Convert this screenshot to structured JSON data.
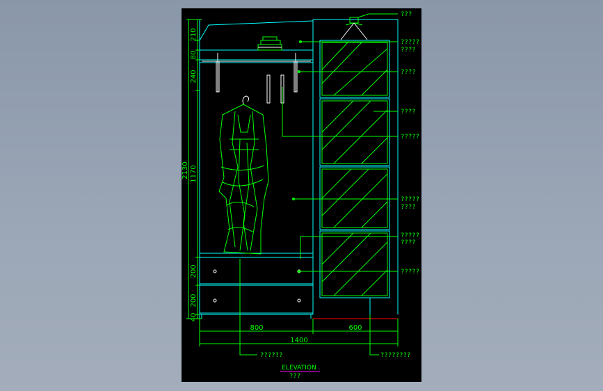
{
  "drawing": {
    "title": "ELEVATION",
    "subtitle": "???",
    "colors": {
      "viewport_bg": "#8e9aab",
      "sheet": "#000000",
      "cabinet": "#00ffff",
      "dimension": "#00ff00",
      "figure": "#00ff00",
      "hardware": "#ffffff",
      "floor": "#ff0000",
      "title_underline": "#ff00ff"
    }
  },
  "dimensions": {
    "vertical_outer": [
      "210",
      "80",
      "240",
      "2130",
      "1170",
      "200",
      "200",
      "40"
    ],
    "vertical_inner": [
      "1170"
    ],
    "horizontal": [
      "800",
      "600",
      "1400"
    ]
  },
  "annotations": {
    "right": [
      "???",
      "?????",
      "????",
      "????",
      "????",
      "?????",
      "?????",
      "????",
      "?????",
      "????",
      "?????"
    ],
    "bottom": [
      "??????",
      "????????"
    ]
  }
}
